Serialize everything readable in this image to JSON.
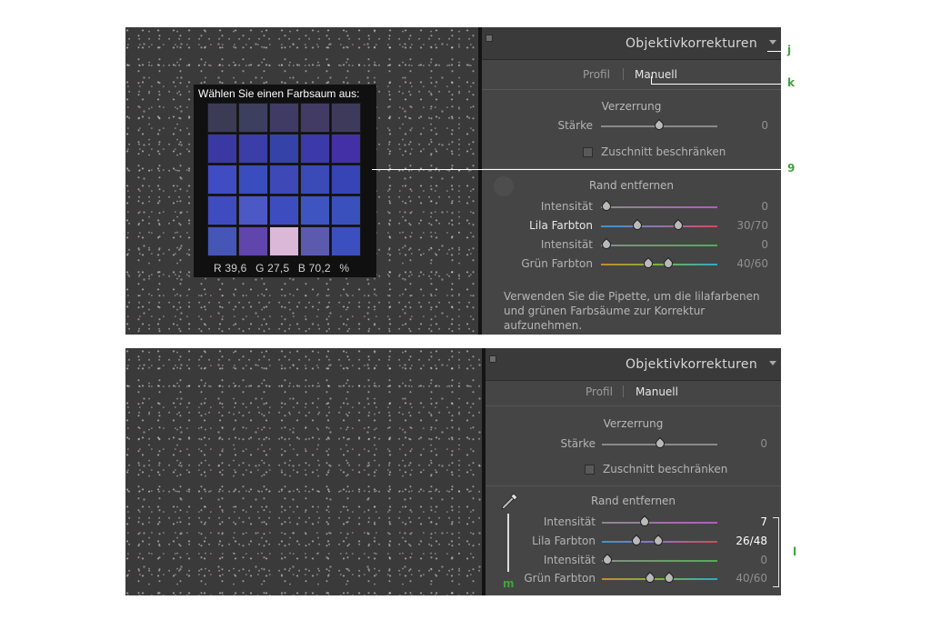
{
  "top_screen": {
    "popup": {
      "title": "Wählen Sie einen Farbsaum aus:",
      "grid_colors": [
        [
          "#3b3b55",
          "#3c3f5e",
          "#3f3b64",
          "#423b63",
          "#3d3a5c"
        ],
        [
          "#3a39a3",
          "#3b3ea9",
          "#3543a8",
          "#3c3aaa",
          "#4430a6"
        ],
        [
          "#3f4cc2",
          "#3a4dbe",
          "#3e48b6",
          "#3a4ab7",
          "#3644b5"
        ],
        [
          "#3f4cc0",
          "#4d58c7",
          "#3d4dbf",
          "#3e54c0",
          "#3a50bd"
        ],
        [
          "#4556b6",
          "#6045ad",
          "#dbb7d8",
          "#5c5aae",
          "#3c4fbe"
        ]
      ],
      "readout": {
        "r": "R 39,6",
        "g": "G 27,5",
        "b": "B 70,2",
        "unit": "%"
      }
    },
    "panel": {
      "title": "Objektivkorrekturen",
      "tab_profile": "Profil",
      "tab_manual": "Manuell",
      "distortion": {
        "title": "Verzerrung",
        "label": "Stärke",
        "value": "0",
        "level": 0.5
      },
      "constrain_crop": "Zuschnitt beschränken",
      "defringe": {
        "title": "Rand entfernen",
        "purple_amount": {
          "label": "Intensität",
          "value": "0",
          "level": 0.0
        },
        "purple_hue": {
          "label": "Lila Farbton",
          "value": "30/70",
          "range": [
            30,
            70
          ]
        },
        "green_amount": {
          "label": "Intensität",
          "value": "0",
          "level": 0.0
        },
        "green_hue": {
          "label": "Grün Farbton",
          "value": "40/60",
          "range": [
            40,
            60
          ]
        }
      },
      "hint": [
        "Verwenden Sie die Pipette, um die lilafarbenen",
        "und grünen Farbsäume zur Korrektur",
        "aufzunehmen."
      ]
    }
  },
  "bottom_screen": {
    "panel": {
      "title": "Objektivkorrekturen",
      "tab_profile": "Profil",
      "tab_manual": "Manuell",
      "distortion": {
        "title": "Verzerrung",
        "label": "Stärke",
        "value": "0",
        "level": 0.5
      },
      "constrain_crop": "Zuschnitt beschränken",
      "defringe": {
        "title": "Rand entfernen",
        "purple_amount": {
          "label": "Intensität",
          "value": "7",
          "level": 0.35
        },
        "purple_hue": {
          "label": "Lila Farbton",
          "value": "26/48",
          "range": [
            26,
            48
          ]
        },
        "green_amount": {
          "label": "Intensität",
          "value": "0",
          "level": 0.0
        },
        "green_hue": {
          "label": "Grün Farbton",
          "value": "40/60",
          "range": [
            40,
            60
          ]
        }
      }
    }
  },
  "callouts": {
    "j": "j",
    "k": "k",
    "nine": "9",
    "l": "l",
    "m": "m"
  }
}
